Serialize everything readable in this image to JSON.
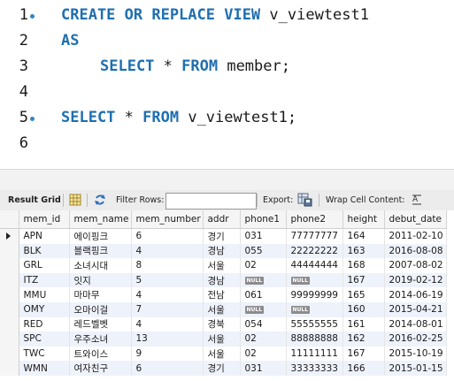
{
  "editor": {
    "lines": [
      {
        "num": "1",
        "dot": true
      },
      {
        "num": "2",
        "dot": false
      },
      {
        "num": "3",
        "dot": false
      },
      {
        "num": "4",
        "dot": false
      },
      {
        "num": "5",
        "dot": true
      },
      {
        "num": "6",
        "dot": false
      }
    ],
    "code": {
      "l1_kw": "CREATE OR REPLACE VIEW",
      "l1_name": " v_viewtest1",
      "l2_kw": "AS",
      "l3_kw1": "SELECT",
      "l3_mid": " * ",
      "l3_kw2": "FROM",
      "l3_rest": " member;",
      "l5_kw1": "SELECT",
      "l5_mid": " * ",
      "l5_kw2": "FROM",
      "l5_rest": " v_viewtest1;"
    },
    "keyword_color": "#1e6fb0"
  },
  "toolbar": {
    "result_grid": "Result Grid",
    "filter_rows": "Filter Rows:",
    "filter_value": "",
    "export": "Export:",
    "wrap": "Wrap Cell Content:"
  },
  "grid": {
    "columns": [
      "mem_id",
      "mem_name",
      "mem_number",
      "addr",
      "phone1",
      "phone2",
      "height",
      "debut_date"
    ],
    "null_label": "NULL",
    "rows": [
      [
        "APN",
        "에이핑크",
        "6",
        "경기",
        "031",
        "77777777",
        "164",
        "2011-02-10"
      ],
      [
        "BLK",
        "블랙핑크",
        "4",
        "경남",
        "055",
        "22222222",
        "163",
        "2016-08-08"
      ],
      [
        "GRL",
        "소녀시대",
        "8",
        "서울",
        "02",
        "44444444",
        "168",
        "2007-08-02"
      ],
      [
        "ITZ",
        "잇지",
        "5",
        "경남",
        null,
        null,
        "167",
        "2019-02-12"
      ],
      [
        "MMU",
        "마마무",
        "4",
        "전남",
        "061",
        "99999999",
        "165",
        "2014-06-19"
      ],
      [
        "OMY",
        "오마이걸",
        "7",
        "서울",
        null,
        null,
        "160",
        "2015-04-21"
      ],
      [
        "RED",
        "레드벨벳",
        "4",
        "경북",
        "054",
        "55555555",
        "161",
        "2014-08-01"
      ],
      [
        "SPC",
        "우주소녀",
        "13",
        "서울",
        "02",
        "88888888",
        "162",
        "2016-02-25"
      ],
      [
        "TWC",
        "트와이스",
        "9",
        "서울",
        "02",
        "11111111",
        "167",
        "2015-10-19"
      ],
      [
        "WMN",
        "여자친구",
        "6",
        "경기",
        "031",
        "33333333",
        "166",
        "2015-01-15"
      ]
    ],
    "selected_row": 0
  }
}
